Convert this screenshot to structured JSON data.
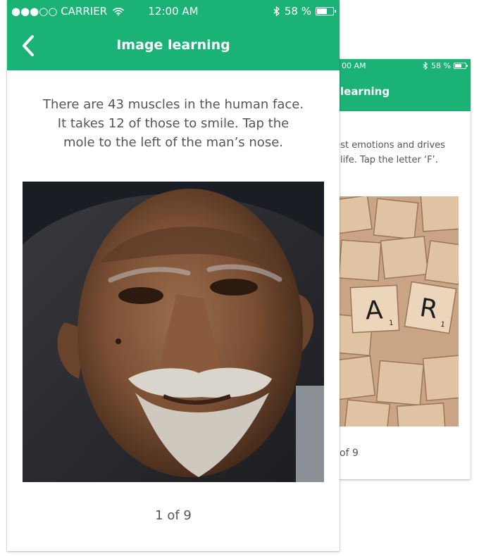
{
  "back_screen": {
    "status": {
      "time_fragment": "00 AM",
      "battery_text": "58 %",
      "battery_level": 0.58
    },
    "nav": {
      "title_fragment": "learning"
    },
    "prompt": "gest emotions and drives\nin life. Tap the letter ‘F’.",
    "image": {
      "tiles": [
        "A",
        "R"
      ],
      "subscript": "1"
    },
    "counter": "of 9"
  },
  "front_screen": {
    "status": {
      "carrier": "●●●○○ CARRIER",
      "time": "12:00 AM",
      "battery_text": "58 %",
      "battery_level": 0.58
    },
    "nav": {
      "title": "Image learning",
      "back_icon": "chevron-left-icon"
    },
    "prompt": "There are 43 muscles in the human face.\nIt takes 12 of those to smile. Tap the\nmole to the left of the man’s nose.",
    "image": {
      "subject": "elderly-man-portrait"
    },
    "counter": "1 of 9"
  },
  "colors": {
    "accent": "#1bb276",
    "text": "#555555",
    "background": "#ffffff"
  }
}
